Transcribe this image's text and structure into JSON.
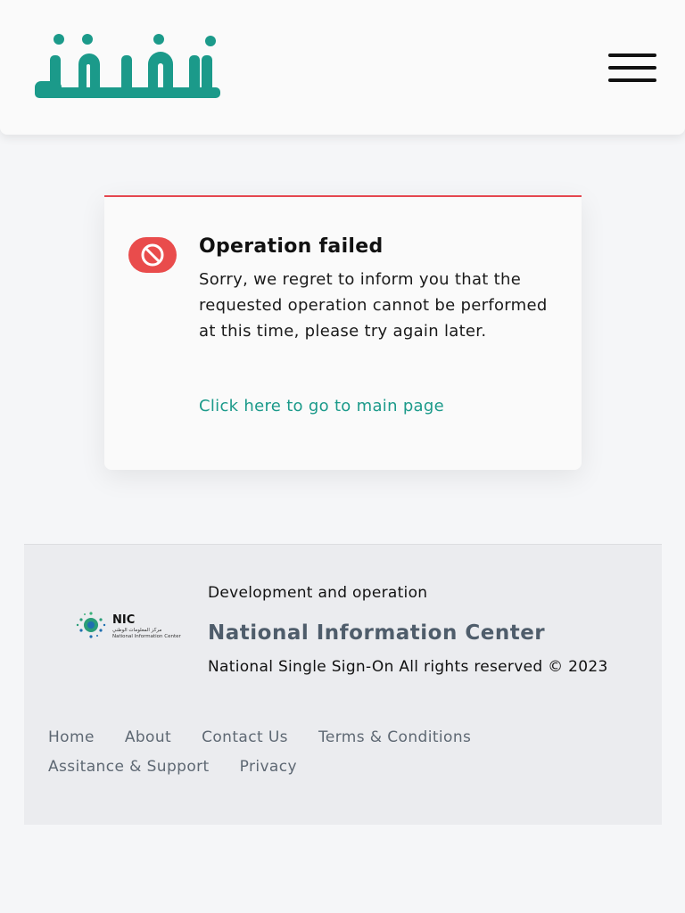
{
  "header": {
    "logo_text": "نفاذ",
    "menu_icon": "hamburger-menu-icon",
    "brand_color": "#1b9a8a"
  },
  "error_card": {
    "icon": "blocked-icon",
    "title": "Operation failed",
    "message": "Sorry, we regret to inform you that the requested operation cannot be performed at this time, please try again later.",
    "link": "Click here to go to main page",
    "accent_color": "#e94c4c",
    "link_color": "#1b9a8a"
  },
  "footer": {
    "logo_text": "NIC",
    "logo_subtext_ar": "مركز المعلومات الوطني",
    "logo_subtext_en": "National Information Center",
    "development_label": "Development and operation",
    "org_name": "National Information Center",
    "rights": "National Single Sign-On All rights reserved © 2023",
    "links": [
      "Home",
      "About",
      "Contact Us",
      "Terms & Conditions",
      "Assitance & Support",
      "Privacy"
    ]
  }
}
